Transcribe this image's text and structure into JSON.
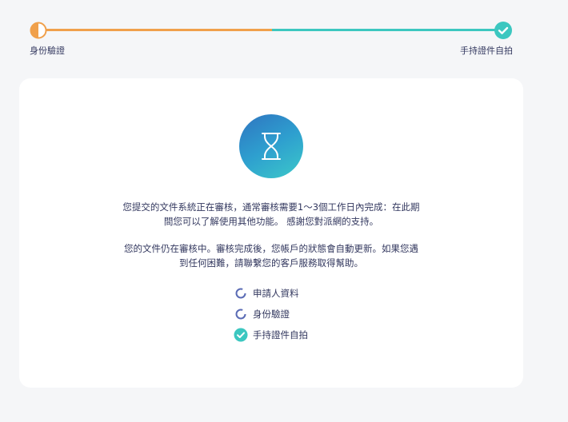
{
  "steps": {
    "start_label": "身份驗證",
    "end_label": "手持證件自拍"
  },
  "card": {
    "message_line1": "您提交的文件系統正在審核，通常審核需要1～3個工作日內完成：在此期",
    "message_line2": "間您可以了解使用其他功能。 感謝您對派網的支持。",
    "message_line3": "您的文件仍在審核中。審核完成後，您帳戶的狀態會自動更新。如果您遇",
    "message_line4": "到任何困難，請聯繫您的客戶服務取得幫助。",
    "checklist": [
      {
        "label": "申請人資料",
        "status": "pending"
      },
      {
        "label": "身份驗證",
        "status": "pending"
      },
      {
        "label": "手持證件自拍",
        "status": "done"
      }
    ]
  },
  "colors": {
    "orange": "#f0a04b",
    "teal": "#3cc7c0",
    "pending_ring": "#5a6bb5",
    "background": "#f5f6f8"
  }
}
